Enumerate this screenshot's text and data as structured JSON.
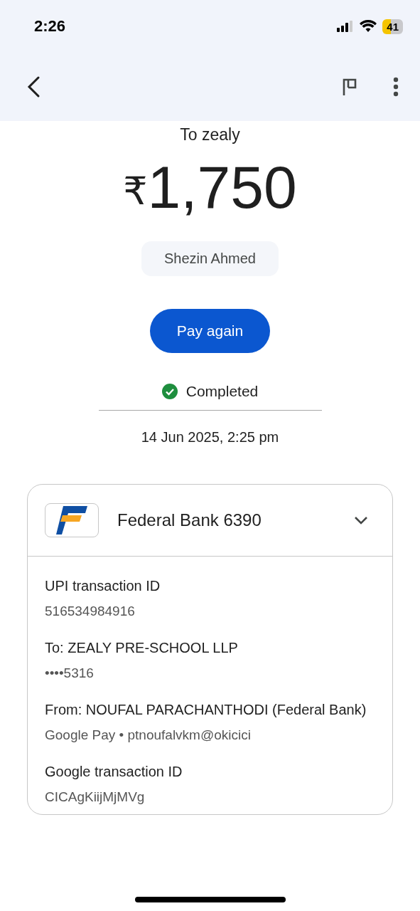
{
  "status_bar": {
    "time": "2:26",
    "battery": "41"
  },
  "payment": {
    "recipient_line": "To zealy",
    "currency": "₹",
    "amount": "1,750",
    "payer": "Shezin Ahmed",
    "action": "Pay again",
    "status": "Completed",
    "date": "14 Jun 2025, 2:25 pm"
  },
  "account_card": {
    "bank": "Federal Bank 6390",
    "expanded": true,
    "details": [
      {
        "label": "UPI transaction ID",
        "value": "516534984916"
      },
      {
        "label": "To: ZEALY PRE-SCHOOL LLP",
        "value": "••••5316"
      },
      {
        "label": "From: NOUFAL PARACHANTHODI (Federal Bank)",
        "value": "Google Pay • ptnoufalvkm@okicici"
      },
      {
        "label": "Google transaction ID",
        "value": "CICAgKiijMjMVg"
      }
    ]
  }
}
